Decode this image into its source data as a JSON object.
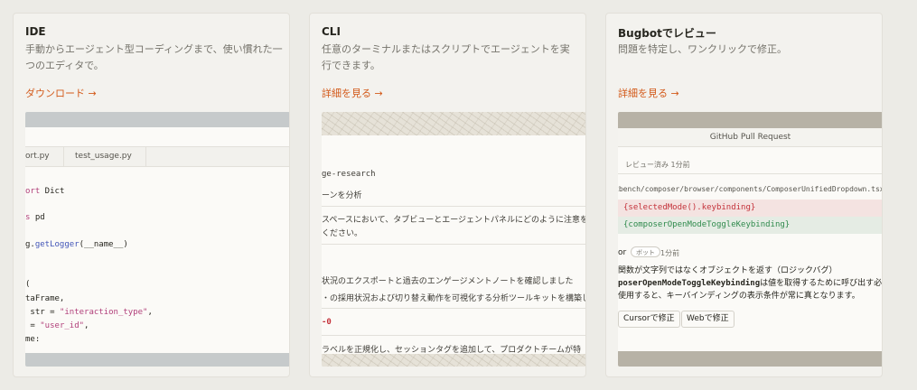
{
  "cards": [
    {
      "title": "IDE",
      "desc": "手動からエージェント型コーディングまで、使い慣れた一つのエディタで。",
      "link": "ダウンロード →",
      "tabs": [
        "ort.py",
        "test_usage.py"
      ],
      "code": [
        {
          "kw": "ort",
          "rest": " Dict"
        },
        {
          "kw": "s",
          "rest": " pd"
        },
        {
          "pre": "g.",
          "fn": "getLogger",
          "rest": "(__name__)"
        },
        {
          "rest": "("
        },
        {
          "rest": "taFrame,"
        },
        {
          "pre": " str = ",
          "str": "\"interaction_type\"",
          "rest": ","
        },
        {
          "pre": " = ",
          "str": "\"user_id\"",
          "rest": ","
        },
        {
          "rest": "me:"
        }
      ]
    },
    {
      "title": "CLI",
      "desc": "任意のターミナルまたはスクリプトでエージェントを実行できます。",
      "link": "詳細を見る →",
      "lines": [
        "ge-research",
        "ーンを分析",
        "スペースにおいて、タブビューとエージェントパネルにどのように注意を分",
        "ください。",
        "状況のエクスポートと過去のエンゲージメントノートを確認しました",
        "・の採用状況および切り替え動作を可視化する分析ツールキットを構築し",
        "-0",
        "ラベルを正規化し、セッションタグを追加して、プロダクトチームが特"
      ]
    },
    {
      "title": "Bugbotでレビュー",
      "desc": "問題を特定し、ワンクリックで修正。",
      "link": "詳細を見る →",
      "header": "GitHub Pull Request",
      "reviewed": "レビュー済み  1分前",
      "filepath": "xbench/composer/browser/components/ComposerUnifiedDropdown.tsx",
      "diff_del": "{selectedMode().keybinding}",
      "diff_add": "{composerOpenModeToggleKeybinding}",
      "author": "or",
      "bot_badge": "ボット",
      "bot_time": "1分前",
      "bug_title": "関数が文字列ではなくオブジェクトを返す（ロジックバグ）",
      "bug_code": "poserOpenModeToggleKeybinding",
      "bug_line1": "は値を取得するために呼び出す必要",
      "bug_line2": "使用すると、キーバインディングの表示条件が常に真となります。",
      "btn_cursor": "Cursorで修正",
      "btn_web": "Webで修正"
    }
  ]
}
